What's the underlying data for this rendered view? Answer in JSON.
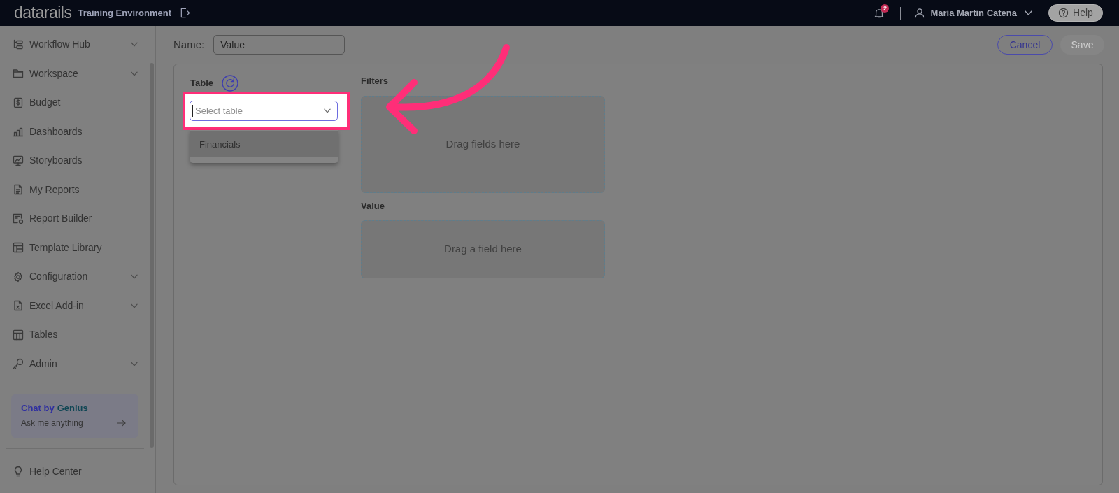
{
  "top_bar": {
    "logo": "datarails",
    "environment": "Training Environment",
    "notification_count": "2",
    "user_name": "Maria Martin Catena",
    "help_button": "Help"
  },
  "sidebar": {
    "items": [
      {
        "label": "Workflow Hub",
        "expandable": true
      },
      {
        "label": "Workspace",
        "expandable": true
      },
      {
        "label": "Budget",
        "expandable": false
      },
      {
        "label": "Dashboards",
        "expandable": false
      },
      {
        "label": "Storyboards",
        "expandable": false
      },
      {
        "label": "My Reports",
        "expandable": false
      },
      {
        "label": "Report Builder",
        "expandable": false
      },
      {
        "label": "Template Library",
        "expandable": false
      },
      {
        "label": "Configuration",
        "expandable": true
      },
      {
        "label": "Excel Add-in",
        "expandable": true
      },
      {
        "label": "Tables",
        "expandable": false
      },
      {
        "label": "Admin",
        "expandable": true
      }
    ],
    "chat_card": {
      "title": "Chat by",
      "title_accent": "Genius",
      "prompt": "Ask me anything"
    },
    "footer_item": {
      "label": "Help Center"
    }
  },
  "header": {
    "name_field": {
      "label": "Name:",
      "value": "Value_"
    },
    "buttons": [
      {
        "label": "Cancel",
        "kind": "secondary",
        "disabled": false
      },
      {
        "label": "Save",
        "kind": "primary",
        "disabled": true
      }
    ]
  },
  "panel": {
    "table_section": {
      "label": "Table",
      "select": {
        "placeholder": "Select table",
        "focused": true,
        "open": true,
        "spotlighted": true
      },
      "options": [
        {
          "label": "Financials",
          "highlighted": true,
          "selected": false
        }
      ]
    },
    "filters": {
      "label": "Filters",
      "placeholder": "Drag fields here"
    },
    "value": {
      "label": "Value",
      "placeholder": "Drag a field here"
    }
  }
}
